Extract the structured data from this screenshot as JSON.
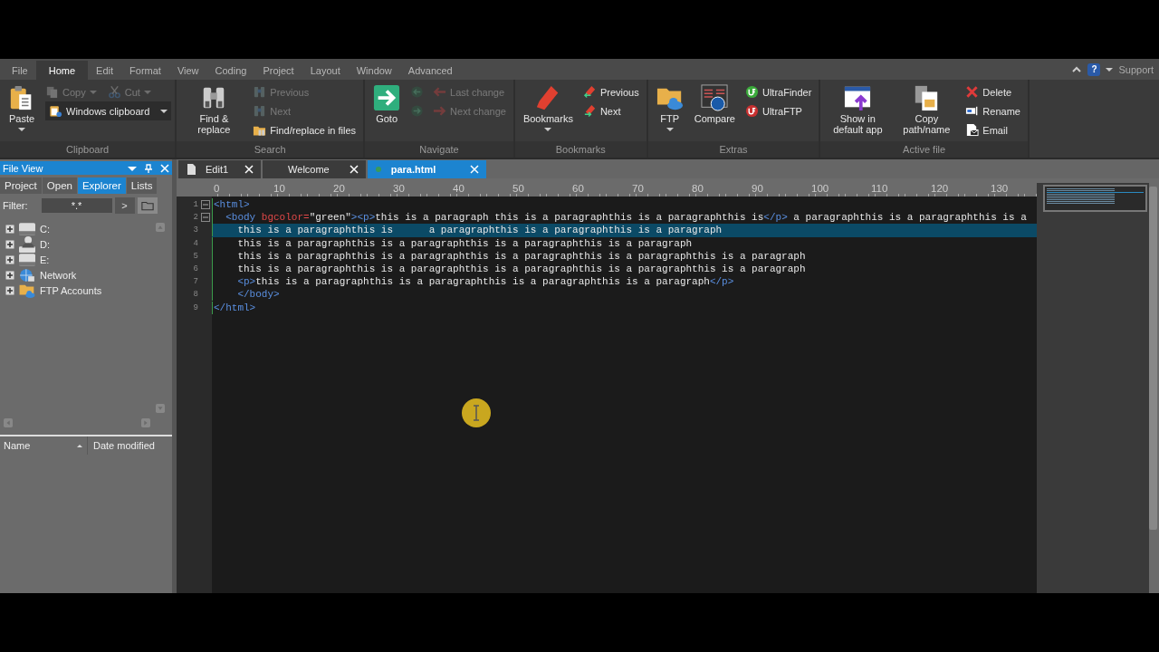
{
  "menu_tabs": [
    {
      "label": "File",
      "selected": false
    },
    {
      "label": "Home",
      "selected": true
    },
    {
      "label": "Edit",
      "selected": false
    },
    {
      "label": "Format",
      "selected": false
    },
    {
      "label": "View",
      "selected": false
    },
    {
      "label": "Coding",
      "selected": false
    },
    {
      "label": "Project",
      "selected": false
    },
    {
      "label": "Layout",
      "selected": false
    },
    {
      "label": "Window",
      "selected": false
    },
    {
      "label": "Advanced",
      "selected": false
    }
  ],
  "help": "?",
  "support": "Support",
  "ribbon": [
    {
      "label": "Clipboard",
      "columns": [
        [
          [
            {
              "label": "Paste",
              "kind": "paste",
              "disabled": false,
              "dropdown": true
            }
          ]
        ],
        [
          [
            {
              "label": "Copy",
              "kind": "copy",
              "disabled": true,
              "dropdown": true
            },
            {
              "label": "Cut",
              "kind": "cut",
              "disabled": true,
              "dropdown": true
            }
          ],
          [
            {
              "label": "Windows clipboard",
              "kind": "clipboard",
              "disabled": false,
              "dropdown": true
            }
          ]
        ]
      ]
    },
    {
      "label": "Search",
      "columns": [
        [
          [
            {
              "label": "Find & replace",
              "kind": "binoculars",
              "disabled": false,
              "dropdown": false
            }
          ]
        ],
        [
          [
            {
              "label": "Previous",
              "kind": "findprev",
              "disabled": true,
              "dropdown": false
            }
          ],
          [
            {
              "label": "Next",
              "kind": "findnext",
              "disabled": true,
              "dropdown": false
            }
          ],
          [
            {
              "label": "Find/replace in files",
              "kind": "findfiles",
              "disabled": false,
              "dropdown": false
            }
          ]
        ]
      ]
    },
    {
      "label": "Navigate",
      "columns": [
        [
          [
            {
              "label": "Goto",
              "kind": "goto",
              "disabled": false,
              "dropdown": false
            }
          ]
        ],
        [
          [
            {
              "kind": "back",
              "disabled": true,
              "dropdown": false
            }
          ],
          [
            {
              "kind": "forward",
              "disabled": true,
              "dropdown": false
            }
          ]
        ],
        [
          [
            {
              "label": "Last change",
              "kind": "lastchange",
              "disabled": true,
              "dropdown": false
            }
          ],
          [
            {
              "label": "Next change",
              "kind": "nextchange",
              "disabled": true,
              "dropdown": false
            }
          ]
        ]
      ]
    },
    {
      "label": "Bookmarks",
      "columns": [
        [
          [
            {
              "label": "Bookmarks",
              "kind": "bookmark",
              "disabled": false,
              "dropdown": true
            }
          ]
        ],
        [
          [
            {
              "label": "Previous",
              "kind": "bmprev",
              "disabled": false,
              "dropdown": false
            }
          ],
          [
            {
              "label": "Next",
              "kind": "bmnext",
              "disabled": false,
              "dropdown": false
            }
          ]
        ]
      ]
    },
    {
      "label": "Extras",
      "columns": [
        [
          [
            {
              "label": "FTP",
              "kind": "ftp",
              "disabled": false,
              "dropdown": true
            }
          ]
        ],
        [
          [
            {
              "label": "Compare",
              "kind": "compare",
              "disabled": false,
              "dropdown": false
            }
          ]
        ],
        [
          [
            {
              "label": "UltraFinder",
              "kind": "ufinder",
              "disabled": false,
              "dropdown": false
            }
          ],
          [
            {
              "label": "UltraFTP",
              "kind": "uftp",
              "disabled": false,
              "dropdown": false
            }
          ]
        ]
      ]
    },
    {
      "label": "Active file",
      "columns": [
        [
          [
            {
              "label": "Show in default app",
              "kind": "showapp",
              "disabled": false,
              "dropdown": false
            }
          ]
        ],
        [
          [
            {
              "label": "Copy path/name",
              "kind": "copypath",
              "disabled": false,
              "dropdown": false
            }
          ]
        ],
        [
          [
            {
              "label": "Delete",
              "kind": "delete",
              "disabled": false,
              "dropdown": false
            }
          ],
          [
            {
              "label": "Rename",
              "kind": "rename",
              "disabled": false,
              "dropdown": false
            }
          ],
          [
            {
              "label": "Email",
              "kind": "email",
              "disabled": false,
              "dropdown": false
            }
          ]
        ]
      ]
    }
  ],
  "file_view": {
    "title": "File View",
    "tabs": [
      {
        "label": "Project",
        "selected": false
      },
      {
        "label": "Open",
        "selected": false
      },
      {
        "label": "Explorer",
        "selected": true
      },
      {
        "label": "Lists",
        "selected": false
      }
    ],
    "filter_label": "Filter:",
    "filter_value": "*.*",
    "go_button": ">",
    "tree": [
      {
        "label": "C:",
        "kind": "drive",
        "expanded": false
      },
      {
        "label": "D:",
        "kind": "userdrive",
        "expanded": false
      },
      {
        "label": "E:",
        "kind": "drive",
        "expanded": false
      },
      {
        "label": "Network",
        "kind": "network",
        "expanded": false
      },
      {
        "label": "FTP Accounts",
        "kind": "ftp",
        "expanded": false
      }
    ],
    "columns": [
      "Name",
      "Date modified"
    ]
  },
  "editor_tabs": [
    {
      "label": "Edit1",
      "selected": false,
      "modified": false
    },
    {
      "label": "Welcome",
      "selected": false,
      "modified": false
    },
    {
      "label": "para.html",
      "selected": true,
      "modified": true
    }
  ],
  "ruler": [
    "0",
    "10",
    "20",
    "30",
    "40",
    "50",
    "60",
    "70",
    "80",
    "90",
    "100",
    "110",
    "120",
    "130"
  ],
  "code": [
    {
      "number": "1",
      "fold": true,
      "selected": false,
      "segments": [
        {
          "kind": "tag",
          "text": "<html>"
        }
      ]
    },
    {
      "number": "2",
      "fold": true,
      "selected": false,
      "segments": [
        {
          "kind": "tag",
          "text": "  <body "
        },
        {
          "kind": "attr",
          "text": "bgcolor="
        },
        {
          "kind": "value",
          "text": "\"green\""
        },
        {
          "kind": "tag",
          "text": "><p>"
        },
        {
          "kind": "text",
          "text": "this is a paragraph this is a paragraphthis is a paragraphthis is"
        },
        {
          "kind": "tag",
          "text": "</p>"
        },
        {
          "kind": "text",
          "text": " a paragraphthis is a paragraphthis is a"
        }
      ]
    },
    {
      "number": "3",
      "fold": false,
      "selected": true,
      "segments": [
        {
          "kind": "text",
          "text": "    this is a paragraphthis is      a paragraphthis is a paragraphthis is a paragraph"
        }
      ]
    },
    {
      "number": "4",
      "fold": false,
      "selected": false,
      "segments": [
        {
          "kind": "text",
          "text": "    this is a paragraphthis is a paragraphthis is a paragraphthis is a paragraph"
        }
      ]
    },
    {
      "number": "5",
      "fold": false,
      "selected": false,
      "segments": [
        {
          "kind": "text",
          "text": "    this is a paragraphthis is a paragraphthis is a paragraphthis is a paragraphthis is a paragraph"
        }
      ]
    },
    {
      "number": "6",
      "fold": false,
      "selected": false,
      "segments": [
        {
          "kind": "text",
          "text": "    this is a paragraphthis is a paragraphthis is a paragraphthis is a paragraphthis is a paragraph"
        }
      ]
    },
    {
      "number": "7",
      "fold": false,
      "selected": false,
      "segments": [
        {
          "kind": "tag",
          "text": "    <p>"
        },
        {
          "kind": "text",
          "text": "this is a paragraphthis is a paragraphthis is a paragraphthis is a paragraph"
        },
        {
          "kind": "tag",
          "text": "</p>"
        }
      ]
    },
    {
      "number": "8",
      "fold": false,
      "selected": false,
      "segments": [
        {
          "kind": "tag",
          "text": "    </body>"
        }
      ]
    },
    {
      "number": "9",
      "fold": false,
      "selected": false,
      "segments": [
        {
          "kind": "tag",
          "text": "</html>"
        }
      ]
    }
  ]
}
